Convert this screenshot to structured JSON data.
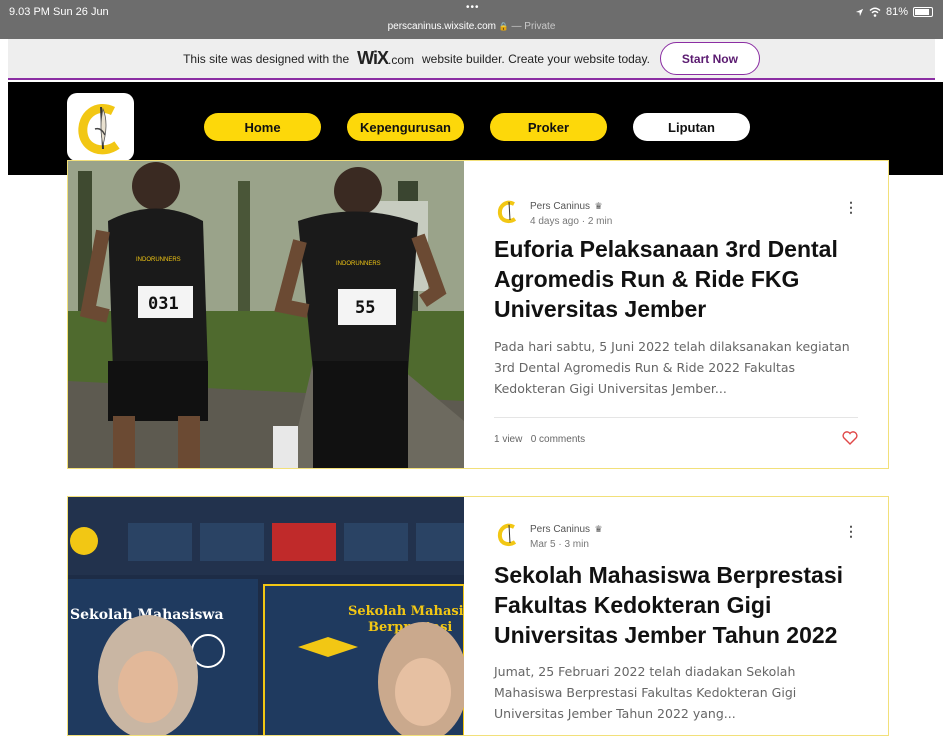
{
  "status_bar": {
    "time": "9.03 PM  Sun 26 Jun",
    "dots": "•••",
    "url": "perscaninus.wixsite.com",
    "lock": "🔒",
    "private_label": "— Private",
    "battery": "81%",
    "icons": [
      "location-icon",
      "wifi-icon",
      "battery-icon"
    ]
  },
  "wix_banner": {
    "text_before": "This site was designed with the",
    "logo_wix": "WiX",
    "logo_com": ".com",
    "text_after": "website builder. Create your website today.",
    "button": "Start Now"
  },
  "nav": {
    "items": [
      {
        "label": "Home"
      },
      {
        "label": "Kepengurusan"
      },
      {
        "label": "Proker"
      },
      {
        "label": "Liputan"
      }
    ]
  },
  "posts": [
    {
      "author": "Pers Caninus",
      "date": "4 days ago",
      "read_time": "2 min",
      "title": "Euforia Pelaksanaan 3rd Dental Agromedis Run & Ride FKG Universitas Jember",
      "excerpt": "Pada hari sabtu, 5 Juni 2022 telah dilaksanakan kegiatan 3rd Dental Agromedis Run & Ride 2022 Fakultas Kedokteran Gigi Universitas Jember...",
      "views": "1 view",
      "comments": "0 comments",
      "image": {
        "bibs": [
          "031",
          "55"
        ],
        "shirt_text": "INDORUNNERS"
      }
    },
    {
      "author": "Pers Caninus",
      "date": "Mar 5",
      "read_time": "3 min",
      "title": "Sekolah Mahasiswa Berprestasi Fakultas Kedokteran Gigi Universitas Jember Tahun 2022",
      "excerpt": "Jumat, 25 Februari 2022 telah diadakan Sekolah Mahasiswa Berprestasi Fakultas Kedokteran Gigi Universitas Jember Tahun 2022 yang...",
      "image": {
        "slide_text": [
          "Sekolah Mahasiswa",
          "Sekolah Mahasiswa",
          "Berprestasi"
        ]
      }
    }
  ],
  "colors": {
    "accent_yellow": "#fdd80a",
    "wix_purple": "#8b2ea3",
    "card_border": "#f2e07a",
    "heart": "#e04848"
  }
}
